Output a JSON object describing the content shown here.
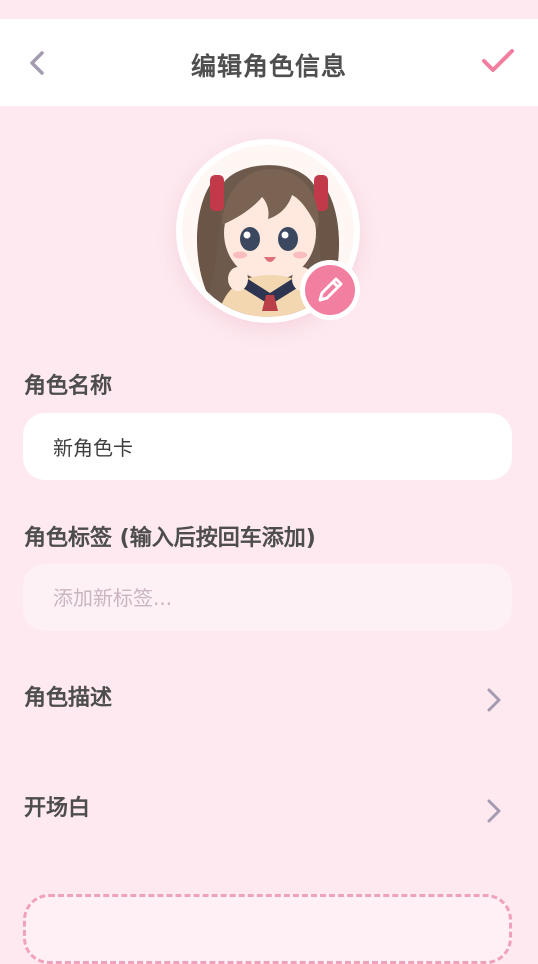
{
  "header": {
    "title": "编辑角色信息"
  },
  "avatar": {
    "description": "anime character avatar"
  },
  "fields": {
    "name_label": "角色名称",
    "name_value": "新角色卡",
    "tags_label": "角色标签 (输入后按回车添加)",
    "tags_placeholder": "添加新标签..."
  },
  "rows": {
    "description_label": "角色描述",
    "opening_label": "开场白"
  },
  "bottom": {
    "button_label": ""
  },
  "colors": {
    "background": "#fde9ef",
    "accent": "#f27ea0",
    "chevron": "#a59bb1"
  }
}
